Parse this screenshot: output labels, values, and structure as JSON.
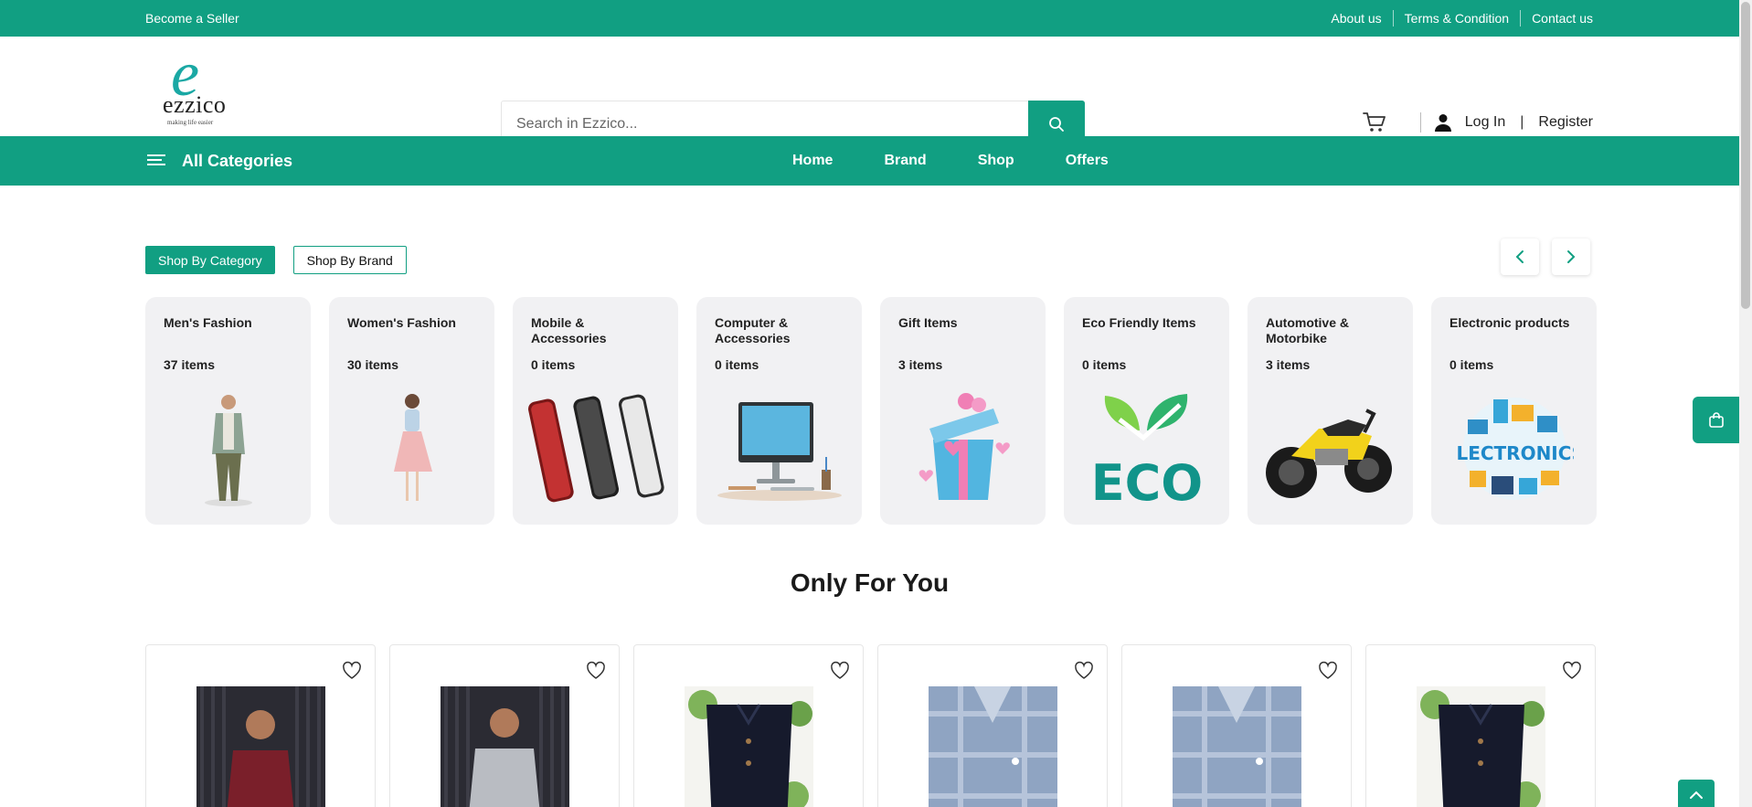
{
  "topbar": {
    "seller_link": "Become a Seller",
    "about": "About us",
    "terms": "Terms & Condition",
    "contact": "Contact us"
  },
  "brand": {
    "logo_letter": "e",
    "name": "ezzico",
    "tagline": "making life easier"
  },
  "search": {
    "placeholder": "Search in Ezzico...",
    "icon": "search-icon"
  },
  "account": {
    "login": "Log In",
    "separator": "|",
    "register": "Register"
  },
  "nav": {
    "all_categories": "All Categories",
    "items": [
      "Home",
      "Brand",
      "Shop",
      "Offers"
    ]
  },
  "shop_tabs": {
    "by_category": "Shop By Category",
    "by_brand": "Shop By Brand"
  },
  "categories": [
    {
      "name": "Men's Fashion",
      "count": "37 items"
    },
    {
      "name": "Women's Fashion",
      "count": "30 items"
    },
    {
      "name": "Mobile & Accessories",
      "count": "0 items"
    },
    {
      "name": "Computer & Accessories",
      "count": "0 items"
    },
    {
      "name": "Gift Items",
      "count": "3 items"
    },
    {
      "name": "Eco Friendly Items",
      "count": "0 items"
    },
    {
      "name": "Automotive & Motorbike",
      "count": "3 items"
    },
    {
      "name": "Electronic products",
      "count": "0 items"
    }
  ],
  "category_images": {
    "eco_text": "ECO",
    "electronics_text": "ELECTRONICS"
  },
  "section": {
    "only_for_you": "Only For You"
  },
  "colors": {
    "accent": "#119f82",
    "card_bg": "#f1f1f3"
  }
}
